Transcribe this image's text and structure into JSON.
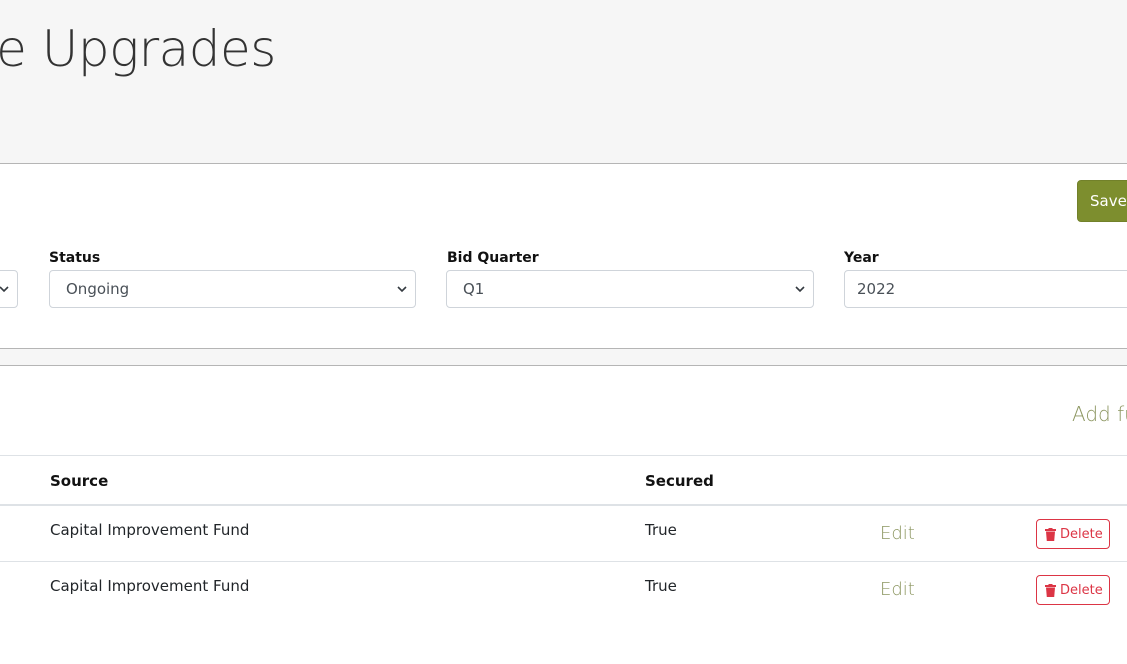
{
  "header": {
    "title": "oe Upgrades"
  },
  "form": {
    "save_label": "Save",
    "status": {
      "label": "Status",
      "value": "Ongoing"
    },
    "bid_quarter": {
      "label": "Bid Quarter",
      "value": "Q1"
    },
    "year": {
      "label": "Year",
      "value": "2022"
    }
  },
  "funding": {
    "add_link": "Add fu",
    "columns": {
      "source": "Source",
      "secured": "Secured"
    },
    "rows": [
      {
        "source": "Capital Improvement Fund",
        "secured": "True",
        "edit": "Edit",
        "delete": "Delete"
      },
      {
        "source": "Capital Improvement Fund",
        "secured": "True",
        "edit": "Edit",
        "delete": "Delete"
      }
    ]
  },
  "colors": {
    "accent": "#7d8e2e",
    "link": "#8c9660",
    "danger": "#dc3545"
  }
}
